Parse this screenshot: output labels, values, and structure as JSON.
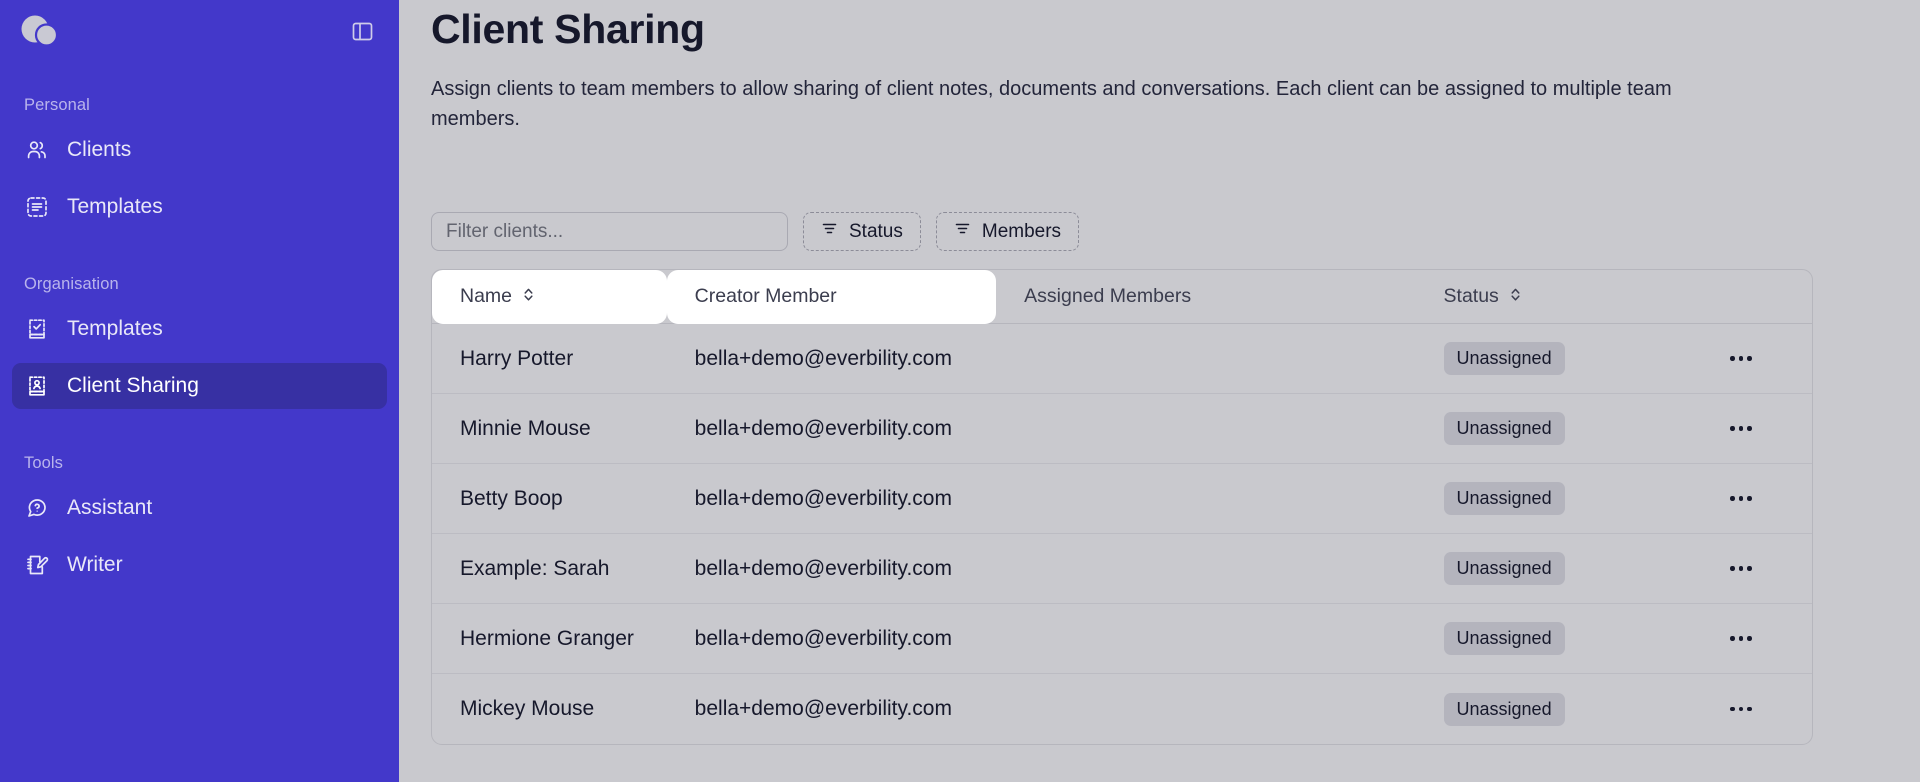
{
  "brand": {
    "logo_icon": "overlapping-circles-logo",
    "sidebar_bg": "#4338CA",
    "sidebar_active_bg": "#3730A3",
    "panel_toggle_icon": "panel-left-toggle-icon"
  },
  "sidebar": {
    "sections": [
      {
        "label": "Personal",
        "items": [
          {
            "label": "Clients",
            "icon": "users-icon",
            "active": false
          },
          {
            "label": "Templates",
            "icon": "template-dashed-icon",
            "active": false
          }
        ]
      },
      {
        "label": "Organisation",
        "items": [
          {
            "label": "Templates",
            "icon": "book-check-icon",
            "active": false
          },
          {
            "label": "Client Sharing",
            "icon": "contact-book-icon",
            "active": true
          }
        ]
      },
      {
        "label": "Tools",
        "items": [
          {
            "label": "Assistant",
            "icon": "chat-question-icon",
            "active": false
          },
          {
            "label": "Writer",
            "icon": "notebook-pen-icon",
            "active": false
          }
        ]
      }
    ]
  },
  "page": {
    "title": "Client Sharing",
    "description": "Assign clients to team members to allow sharing of client notes, documents and conversations. Each client can be assigned to multiple team members."
  },
  "filters": {
    "search_placeholder": "Filter clients...",
    "search_value": "",
    "chips": [
      {
        "label": "Status",
        "icon": "filter-icon"
      },
      {
        "label": "Members",
        "icon": "filter-icon"
      }
    ]
  },
  "table": {
    "columns": [
      {
        "key": "name",
        "label": "Name",
        "sortable": true,
        "highlighted": true
      },
      {
        "key": "creator",
        "label": "Creator Member",
        "sortable": false,
        "highlighted": true
      },
      {
        "key": "assigned",
        "label": "Assigned Members",
        "sortable": false,
        "highlighted": false
      },
      {
        "key": "status",
        "label": "Status",
        "sortable": true,
        "highlighted": false
      },
      {
        "key": "actions",
        "label": "",
        "sortable": false,
        "highlighted": false
      }
    ],
    "rows": [
      {
        "name": "Harry Potter",
        "creator": "bella+demo@everbility.com",
        "assigned": "",
        "status": "Unassigned",
        "actions_icon": "ellipsis-icon"
      },
      {
        "name": "Minnie Mouse",
        "creator": "bella+demo@everbility.com",
        "assigned": "",
        "status": "Unassigned",
        "actions_icon": "ellipsis-icon"
      },
      {
        "name": "Betty Boop",
        "creator": "bella+demo@everbility.com",
        "assigned": "",
        "status": "Unassigned",
        "actions_icon": "ellipsis-icon"
      },
      {
        "name": "Example: Sarah",
        "creator": "bella+demo@everbility.com",
        "assigned": "",
        "status": "Unassigned",
        "actions_icon": "ellipsis-icon"
      },
      {
        "name": "Hermione Granger",
        "creator": "bella+demo@everbility.com",
        "assigned": "",
        "status": "Unassigned",
        "actions_icon": "ellipsis-icon"
      },
      {
        "name": "Mickey Mouse",
        "creator": "bella+demo@everbility.com",
        "assigned": "",
        "status": "Unassigned",
        "actions_icon": "ellipsis-icon"
      }
    ]
  }
}
